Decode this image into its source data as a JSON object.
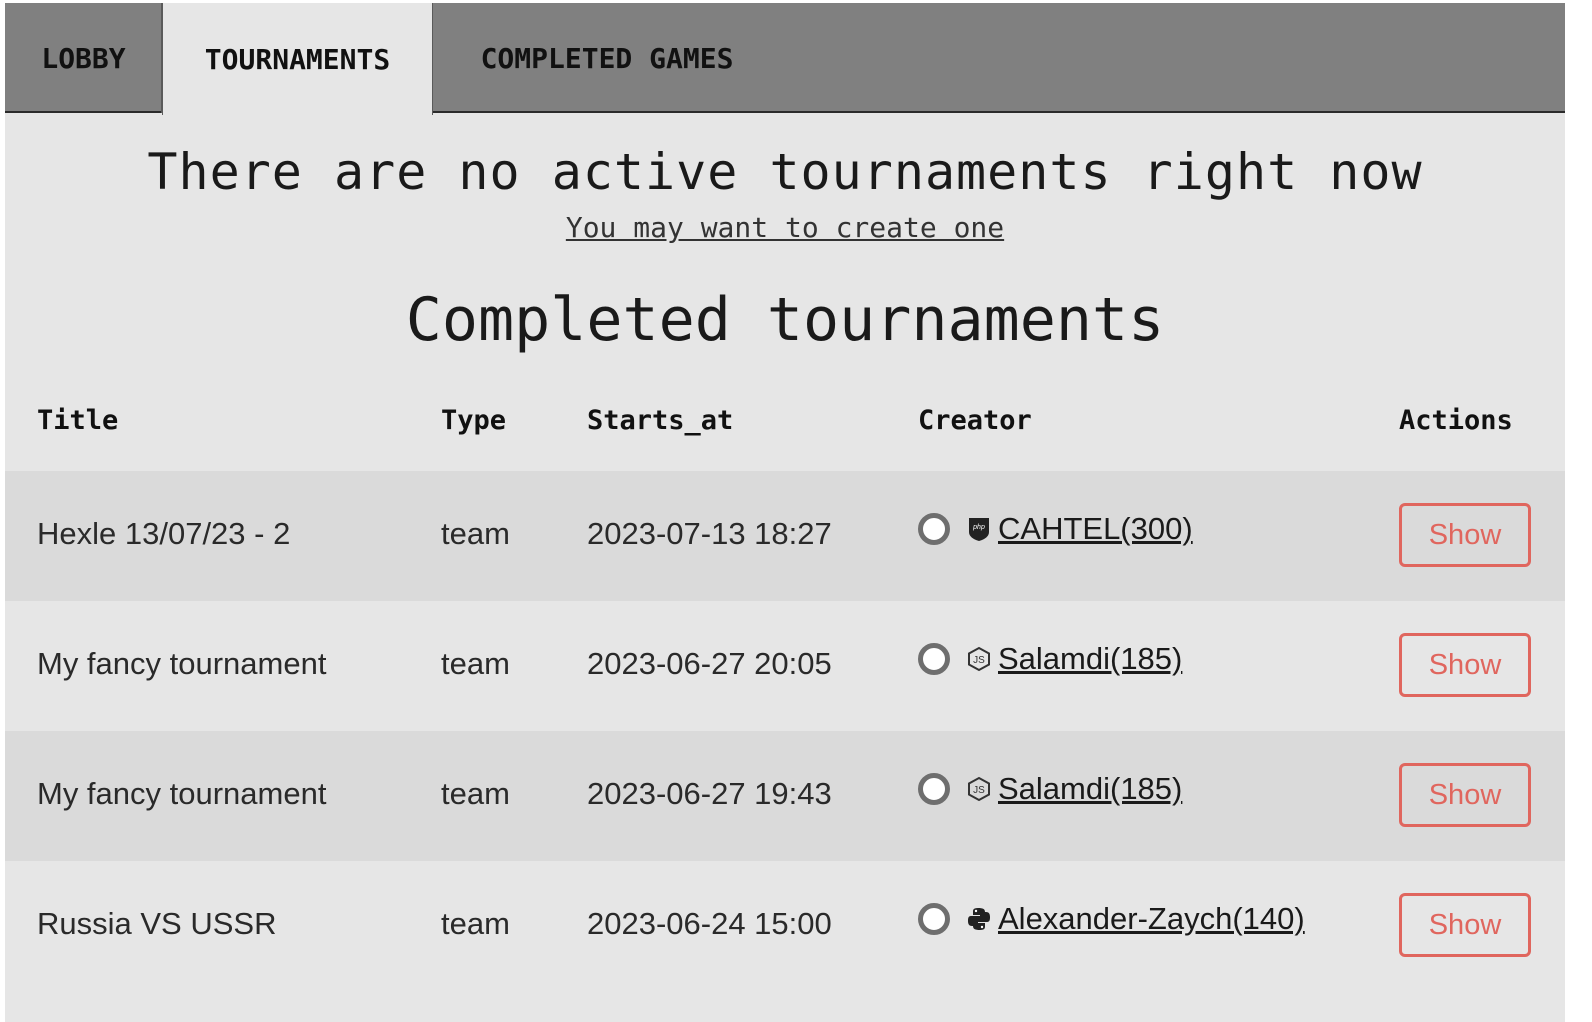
{
  "tabs": {
    "lobby": "LOBBY",
    "tournaments": "TOURNAMENTS",
    "completed_games": "COMPLETED GAMES"
  },
  "active": {
    "empty_title": "There are no active tournaments right now",
    "create_link": "You may want to create one"
  },
  "completed": {
    "title": "Completed tournaments",
    "headers": {
      "title": "Title",
      "type": "Type",
      "starts_at": "Starts_at",
      "creator": "Creator",
      "actions": "Actions"
    },
    "rows": [
      {
        "title": "Hexle 13/07/23 - 2",
        "type": "team",
        "starts_at": "2023-07-13 18:27",
        "creator_lang_icon": "php-icon",
        "creator": "CAHTEL(300)",
        "action": "Show"
      },
      {
        "title": "My fancy tournament",
        "type": "team",
        "starts_at": "2023-06-27 20:05",
        "creator_lang_icon": "nodejs-icon",
        "creator": "Salamdi(185)",
        "action": "Show"
      },
      {
        "title": "My fancy tournament",
        "type": "team",
        "starts_at": "2023-06-27 19:43",
        "creator_lang_icon": "nodejs-icon",
        "creator": "Salamdi(185)",
        "action": "Show"
      },
      {
        "title": "Russia VS USSR",
        "type": "team",
        "starts_at": "2023-06-24 15:00",
        "creator_lang_icon": "python-icon",
        "creator": "Alexander-Zaych(140)",
        "action": "Show"
      }
    ]
  },
  "colors": {
    "tabbar": "#808080",
    "background": "#e6e6e6",
    "row_stripe": "#dadada",
    "show_button": "#e0665e"
  }
}
